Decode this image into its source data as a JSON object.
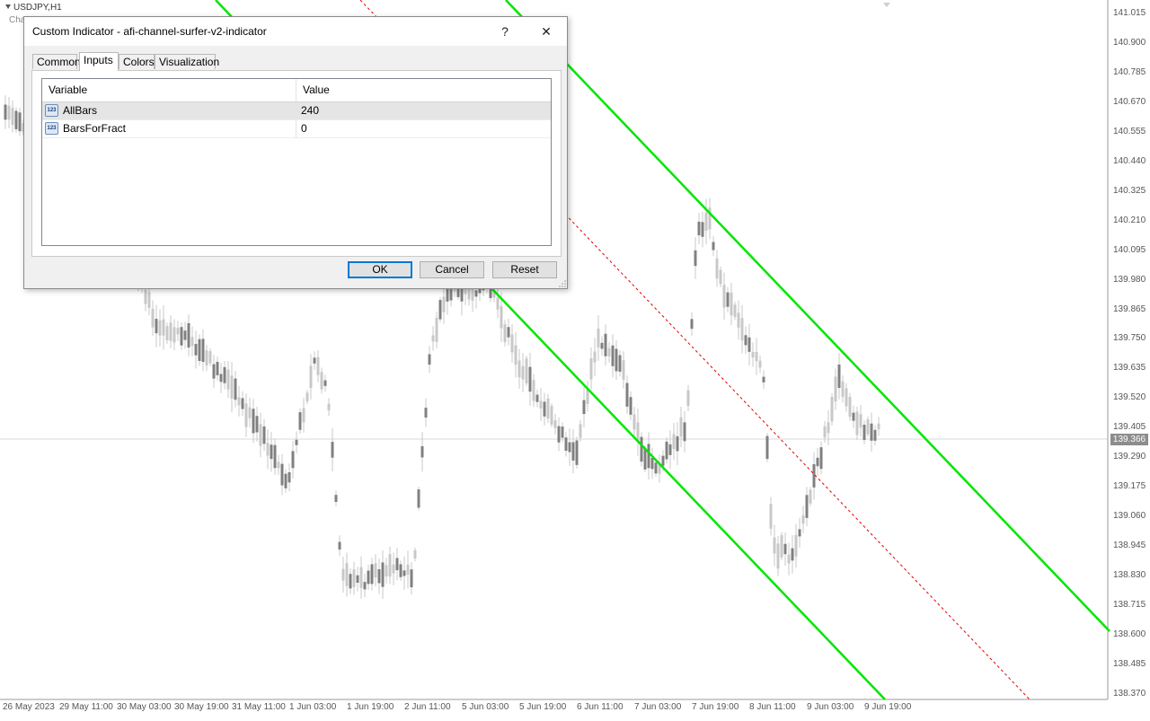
{
  "chart": {
    "symbol": "USDJPY,H1",
    "subtitle": "Cha",
    "current_price": "139.366",
    "price_axis": [
      "141.015",
      "140.900",
      "140.785",
      "140.670",
      "140.555",
      "140.440",
      "140.325",
      "140.210",
      "140.095",
      "139.980",
      "139.865",
      "139.750",
      "139.635",
      "139.520",
      "139.405",
      "139.290",
      "139.175",
      "139.060",
      "138.945",
      "138.830",
      "138.715",
      "138.600",
      "138.485",
      "138.370"
    ],
    "time_axis": [
      "26 May 2023",
      "29 May 11:00",
      "30 May 03:00",
      "30 May 19:00",
      "31 May 11:00",
      "1 Jun 03:00",
      "1 Jun 19:00",
      "2 Jun 11:00",
      "5 Jun 03:00",
      "5 Jun 19:00",
      "6 Jun 11:00",
      "7 Jun 03:00",
      "7 Jun 19:00",
      "8 Jun 11:00",
      "9 Jun 03:00",
      "9 Jun 19:00"
    ],
    "colors": {
      "channel": "#00e600",
      "midline": "#e00000",
      "candle": "#808080",
      "candle_light": "#c8c8c8",
      "current_price_bg": "#8c8c8c"
    }
  },
  "dialog": {
    "title": "Custom Indicator - afi-channel-surfer-v2-indicator",
    "help_glyph": "?",
    "close_glyph": "✕",
    "tabs": [
      {
        "label": "Common",
        "active": false
      },
      {
        "label": "Inputs",
        "active": true
      },
      {
        "label": "Colors",
        "active": false
      },
      {
        "label": "Visualization",
        "active": false
      }
    ],
    "grid": {
      "col_variable": "Variable",
      "col_value": "Value",
      "rows": [
        {
          "icon": "numeric-type-icon",
          "icon_text": "123",
          "variable": "AllBars",
          "value": "240"
        },
        {
          "icon": "numeric-type-icon",
          "icon_text": "123",
          "variable": "BarsForFract",
          "value": "0"
        }
      ]
    },
    "buttons": {
      "ok": "OK",
      "cancel": "Cancel",
      "reset": "Reset"
    }
  }
}
